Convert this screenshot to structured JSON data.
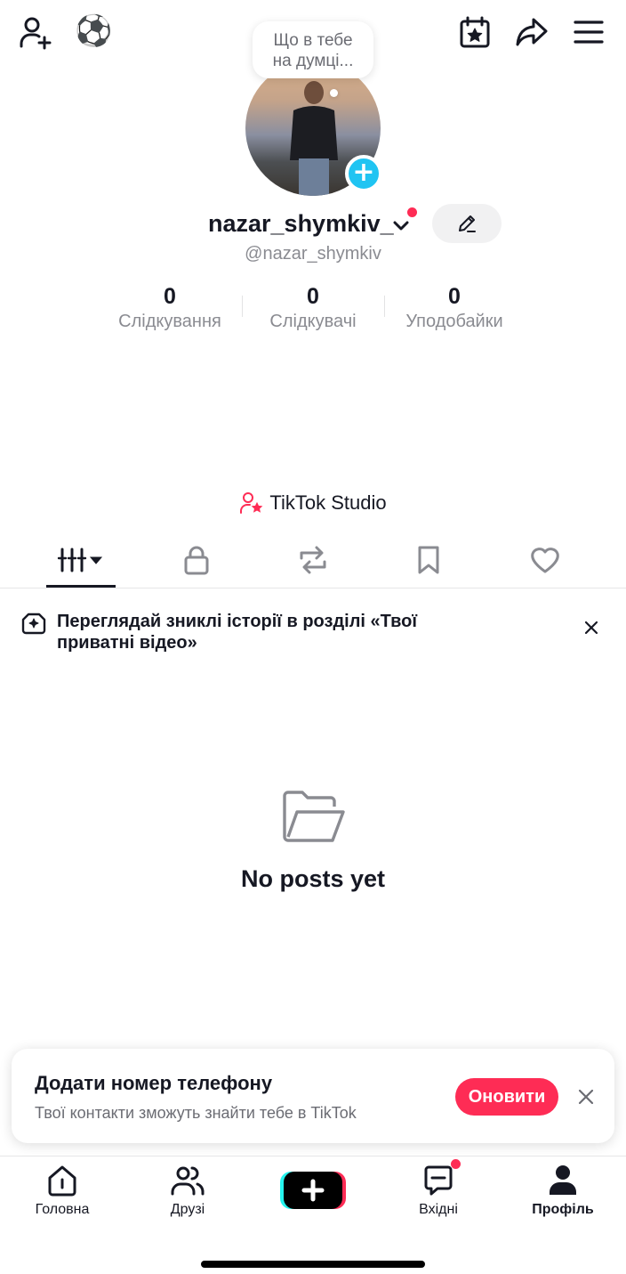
{
  "header": {
    "add_friend_icon": "person-plus-icon",
    "emoji": "⚽",
    "calendar_icon": "calendar-star-icon",
    "share_icon": "share-arrow-icon",
    "menu_icon": "hamburger-menu-icon"
  },
  "profile": {
    "thought_bubble": [
      "Що в тебе",
      "на думці..."
    ],
    "username": "nazar_shymkiv_",
    "handle": "@nazar_shymkiv",
    "stats": [
      {
        "value": "0",
        "label": "Слідкування"
      },
      {
        "value": "0",
        "label": "Слідкувачі"
      },
      {
        "value": "0",
        "label": "Уподобайки"
      }
    ]
  },
  "studio": {
    "label": "TikTok Studio"
  },
  "tabs": [
    {
      "name": "videos",
      "icon": "grid-bars-icon"
    },
    {
      "name": "private",
      "icon": "lock-icon"
    },
    {
      "name": "reposts",
      "icon": "repost-icon"
    },
    {
      "name": "saved",
      "icon": "bookmark-icon"
    },
    {
      "name": "liked",
      "icon": "heart-icon"
    }
  ],
  "notice": {
    "text": "Переглядай зниклі історії в розділі «Твої приватні відео»"
  },
  "empty_state": {
    "text": "No posts yet"
  },
  "phone_card": {
    "title": "Додати номер телефону",
    "subtitle": "Твої контакти зможуть знайти тебе в TikTok",
    "button": "Оновити"
  },
  "bottom_nav": [
    {
      "label": "Головна",
      "icon": "home-icon"
    },
    {
      "label": "Друзі",
      "icon": "friends-icon"
    },
    {
      "label": "",
      "icon": "create-plus-icon"
    },
    {
      "label": "Вхідні",
      "icon": "inbox-icon"
    },
    {
      "label": "Профіль",
      "icon": "profile-icon"
    }
  ],
  "colors": {
    "accent": "#fe2c55",
    "cyan": "#20c4f2",
    "text": "#161823",
    "muted": "#8a8b91"
  }
}
